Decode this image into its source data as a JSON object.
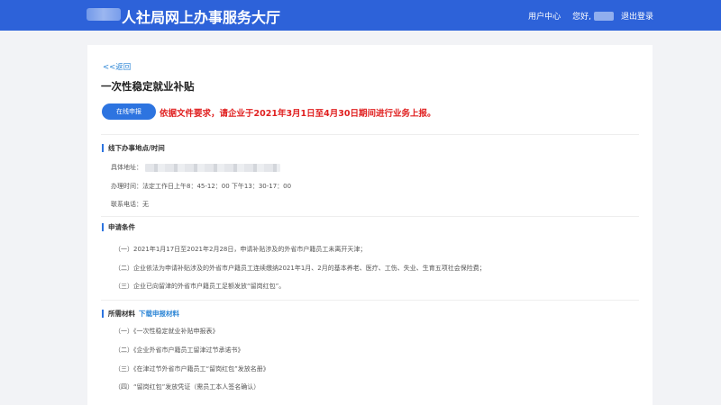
{
  "header": {
    "site_title": "人社局网上办事服务大厅",
    "user_center": "用户中心",
    "greeting": "您好,",
    "logout": "退出登录"
  },
  "page": {
    "back": "<<返回",
    "title": "一次性稳定就业补贴",
    "apply_button": "在线申报",
    "notice": "依据文件要求，请企业于2021年3月1日至4月30日期间进行业务上报。"
  },
  "offline": {
    "heading": "线下办事地点/时间",
    "address_label": "具体地址：",
    "hours": "办理时间：法定工作日上午8：45-12：00 下午13：30-17：00",
    "phone": "联系电话：无"
  },
  "conditions": {
    "heading": "申请条件",
    "items": [
      "（一）2021年1月17日至2021年2月28日，申请补贴涉及的外省市户籍员工未离开天津；",
      "（二）企业依法为申请补贴涉及的外省市户籍员工连续缴纳2021年1月、2月的基本养老、医疗、工伤、失业、生育五项社会保险费；",
      "（三）企业已向留津的外省市户籍员工足额发放“留岗红包”。"
    ]
  },
  "materials": {
    "heading": "所需材料",
    "download": "下载申报材料",
    "items": [
      "（一）《一次性稳定就业补贴申报表》",
      "（二）《企业外省市户籍员工留津过节承诺书》",
      "（三）《在津过节外省市户籍员工“留岗红包”发放名册》",
      "（四）“留岗红包”发放凭证（需员工本人签名确认）"
    ]
  }
}
